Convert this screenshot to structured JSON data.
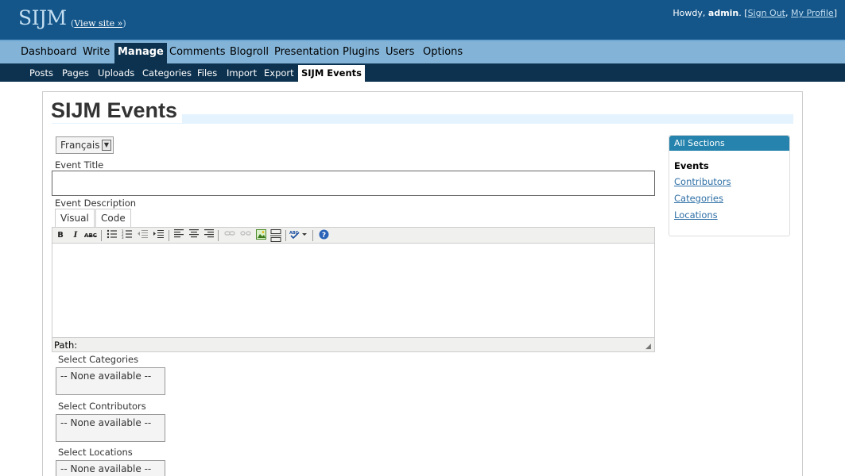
{
  "header": {
    "site_title": "SIJM",
    "view_site_open": "(",
    "view_site_link": "View site »",
    "view_site_close": ")",
    "howdy": "Howdy,",
    "username": "admin",
    "sep1": ". [",
    "sign_out": "Sign Out",
    "comma": ",",
    "my_profile": "My Profile",
    "sep2": "]"
  },
  "menu": {
    "items": [
      "Dashboard",
      "Write",
      "Manage",
      "Comments",
      "Blogroll",
      "Presentation",
      "Plugins",
      "Users",
      "Options"
    ],
    "current": "Manage"
  },
  "submenu": {
    "items": [
      "Posts",
      "Pages",
      "Uploads",
      "Categories",
      "Files",
      "Import",
      "Export",
      "SIJM Events"
    ],
    "current": "SIJM Events"
  },
  "page": {
    "title": "SIJM Events",
    "language": "Français",
    "event_title_label": "Event Title",
    "event_title_value": "",
    "event_description_label": "Event Description",
    "tabs": [
      "Visual",
      "Code"
    ],
    "path_label": "Path:",
    "select_categories_label": "Select Categories",
    "select_contributors_label": "Select Contributors",
    "select_locations_label": "Select Locations",
    "none_available": "-- None available --"
  },
  "toolbar": {
    "bold": "B",
    "italic": "I",
    "strike": "ABC"
  },
  "sidebar": {
    "header": "All Sections",
    "items": [
      "Events",
      "Contributors",
      "Categories",
      "Locations"
    ],
    "active": "Events"
  }
}
